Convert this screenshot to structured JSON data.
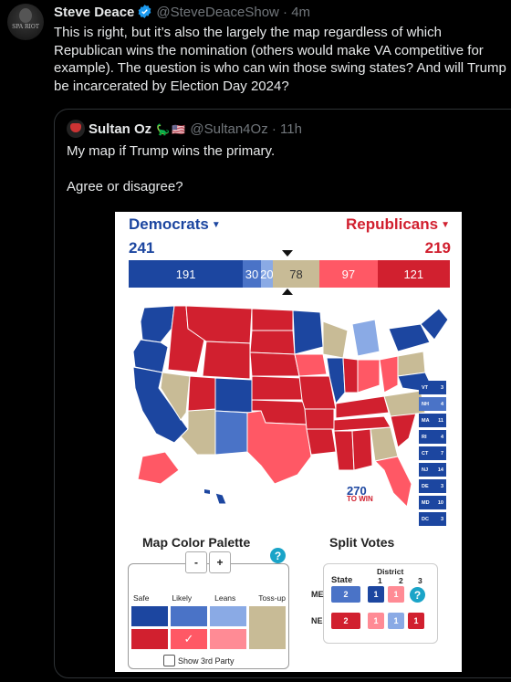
{
  "main_tweet": {
    "display_name": "Steve Deace",
    "handle": "@SteveDeaceShow",
    "time": "4m",
    "avatar_text": "SPA RIOT",
    "text": "This is right, but it’s also the largely the map regardless of which Republican wins the nomination (others would make VA competitive for example). The question is who can win those swing states? And will Trump be incarcerated by Election Day 2024?"
  },
  "quoted_tweet": {
    "display_name": "Sultan Oz",
    "handle": "@Sultan4Oz",
    "time": "11h",
    "text_line1": "My map if Trump wins the primary.",
    "text_line2": "Agree or disagree?"
  },
  "map": {
    "democrats_label": "Democrats",
    "republicans_label": "Republicans",
    "dem_total": "241",
    "rep_total": "219",
    "bar": [
      {
        "label": "191",
        "value": 191,
        "color": "#1c46a0"
      },
      {
        "label": "30",
        "value": 30,
        "color": "#4a73c7"
      },
      {
        "label": "20",
        "value": 20,
        "color": "#8aaae5"
      },
      {
        "label": "78",
        "value": 78,
        "color": "#c8bb96"
      },
      {
        "label": "97",
        "value": 97,
        "color": "#ff5865"
      },
      {
        "label": "121",
        "value": 121,
        "color": "#d1202f"
      }
    ],
    "logo_number": "270",
    "logo_text": "TO WIN",
    "small_states": [
      {
        "abbr": "VT",
        "ev": "3"
      },
      {
        "abbr": "NH",
        "ev": "4"
      },
      {
        "abbr": "MA",
        "ev": "11"
      },
      {
        "abbr": "RI",
        "ev": "4"
      },
      {
        "abbr": "CT",
        "ev": "7"
      },
      {
        "abbr": "NJ",
        "ev": "14"
      },
      {
        "abbr": "DE",
        "ev": "3"
      },
      {
        "abbr": "MD",
        "ev": "10"
      },
      {
        "abbr": "DC",
        "ev": "3"
      }
    ],
    "palette": {
      "title": "Map Color Palette",
      "minus": "-",
      "plus": "+",
      "columns": [
        "Safe",
        "Likely",
        "Leans",
        "Toss-up"
      ],
      "checkbox_label": "Show 3rd Party",
      "colors": {
        "safe_d": "#1c46a0",
        "likely_d": "#4a73c7",
        "leans_d": "#8aaae5",
        "tossup": "#c8bb96",
        "safe_r": "#d1202f",
        "likely_r": "#ff5865",
        "leans_r": "#ff8b95"
      }
    },
    "split_votes": {
      "title": "Split Votes",
      "state_header": "State",
      "district_header": "District",
      "district_numbers": [
        "1",
        "2",
        "3"
      ],
      "rows": [
        {
          "state": "ME",
          "value": "2",
          "d1": "1",
          "d2": "1"
        },
        {
          "state": "NE",
          "value": "2",
          "d1": "1",
          "d2": "1",
          "d3": "1"
        }
      ]
    },
    "help_icon": "?",
    "ne_split": [
      "3",
      "1",
      "1"
    ]
  }
}
